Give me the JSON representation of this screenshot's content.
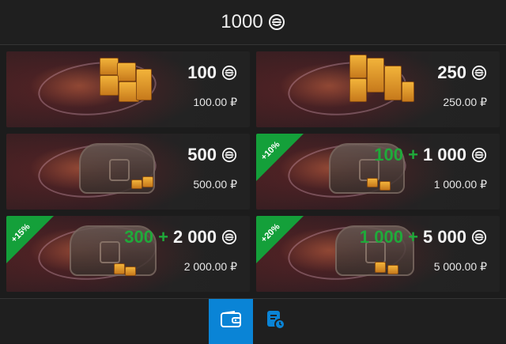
{
  "header": {
    "balance": "1000",
    "currency_icon": "coin-icon"
  },
  "cards": [
    {
      "amount": "100",
      "bonus": "",
      "price": "100.00 ₽",
      "ribbon": ""
    },
    {
      "amount": "250",
      "bonus": "",
      "price": "250.00 ₽",
      "ribbon": ""
    },
    {
      "amount": "500",
      "bonus": "",
      "price": "500.00 ₽",
      "ribbon": ""
    },
    {
      "amount": "1 000",
      "bonus": "100 +",
      "price": "1 000.00 ₽",
      "ribbon": "+10%"
    },
    {
      "amount": "2 000",
      "bonus": "300 +",
      "price": "2 000.00 ₽",
      "ribbon": "+15%"
    },
    {
      "amount": "5 000",
      "bonus": "1 000 +",
      "price": "5 000.00 ₽",
      "ribbon": "+20%"
    }
  ],
  "footer": {
    "tabs": [
      {
        "name": "wallet",
        "icon": "wallet-icon",
        "active": true
      },
      {
        "name": "history",
        "icon": "receipt-clock-icon",
        "active": false
      }
    ]
  },
  "colors": {
    "accent": "#0a84d6",
    "bonus": "#1faa3a",
    "background": "#1c1c1c"
  }
}
